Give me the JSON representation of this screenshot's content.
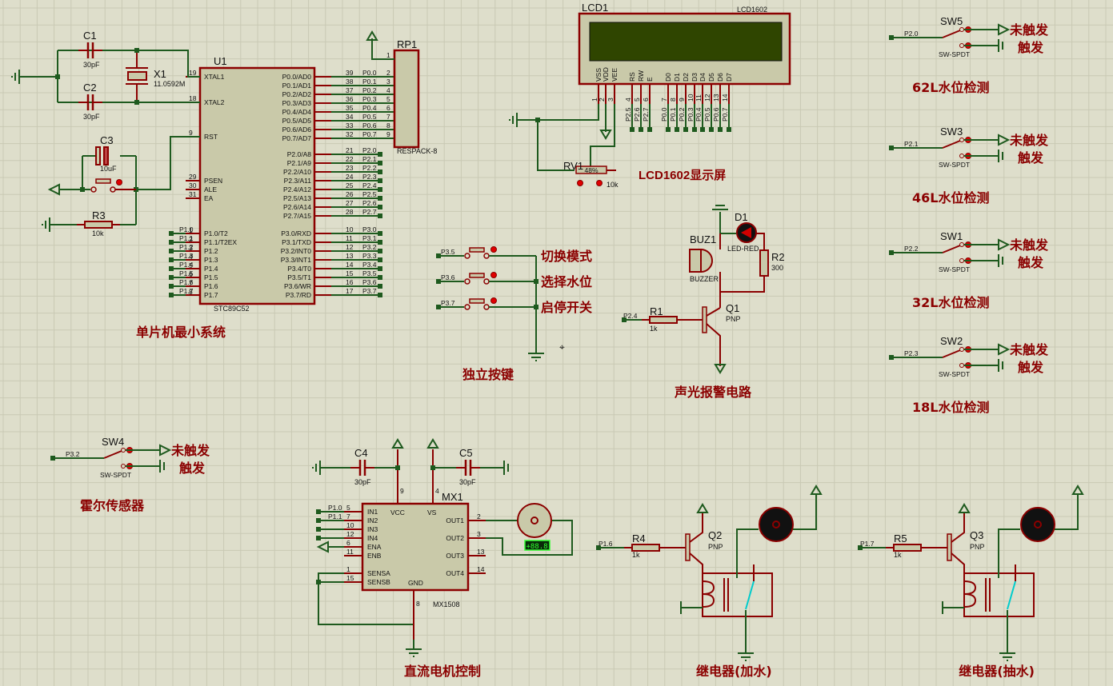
{
  "colors": {
    "background": "#dedecb",
    "grid": "#c9c9b4",
    "wire": "#1e5a1e",
    "component": "#8b0000",
    "body": "#c9c9a9",
    "lcd_screen": "#2f4500",
    "caption": "#8b0000"
  },
  "captions": {
    "mcu": "单片机最小系统",
    "lcd": "LCD1602显示屏",
    "keys": "独立按键",
    "alarm": "声光报警电路",
    "hall": "霍尔传感器",
    "motor": "直流电机控制",
    "relay_add": "继电器(加水)",
    "relay_pump": "继电器(抽水)"
  },
  "u1": {
    "ref": "U1",
    "part": "STC89C52",
    "left": [
      {
        "num": "19",
        "name": "XTAL1"
      },
      {
        "num": "18",
        "name": "XTAL2"
      },
      {
        "num": "9",
        "name": "RST"
      },
      {
        "num": "29",
        "name": "PSEN"
      },
      {
        "num": "30",
        "name": "ALE"
      },
      {
        "num": "31",
        "name": "EA"
      }
    ],
    "p1": [
      {
        "num": "1",
        "name": "P1.0/T2",
        "net": "P1.0"
      },
      {
        "num": "2",
        "name": "P1.1/T2EX",
        "net": "P1.1"
      },
      {
        "num": "3",
        "name": "P1.2",
        "net": "P1.2"
      },
      {
        "num": "4",
        "name": "P1.3",
        "net": "P1.3"
      },
      {
        "num": "5",
        "name": "P1.4",
        "net": "P1.4"
      },
      {
        "num": "6",
        "name": "P1.5",
        "net": "P1.5"
      },
      {
        "num": "7",
        "name": "P1.6",
        "net": "P1.6"
      },
      {
        "num": "8",
        "name": "P1.7",
        "net": "P1.7"
      }
    ],
    "p0": [
      {
        "num": "39",
        "name": "P0.0/AD0",
        "net": "P0.0",
        "rp": "2"
      },
      {
        "num": "38",
        "name": "P0.1/AD1",
        "net": "P0.1",
        "rp": "3"
      },
      {
        "num": "37",
        "name": "P0.2/AD2",
        "net": "P0.2",
        "rp": "4"
      },
      {
        "num": "36",
        "name": "P0.3/AD3",
        "net": "P0.3",
        "rp": "5"
      },
      {
        "num": "35",
        "name": "P0.4/AD4",
        "net": "P0.4",
        "rp": "6"
      },
      {
        "num": "34",
        "name": "P0.5/AD5",
        "net": "P0.5",
        "rp": "7"
      },
      {
        "num": "33",
        "name": "P0.6/AD6",
        "net": "P0.6",
        "rp": "8"
      },
      {
        "num": "32",
        "name": "P0.7/AD7",
        "net": "P0.7",
        "rp": "9"
      }
    ],
    "p2": [
      {
        "num": "21",
        "name": "P2.0/A8",
        "net": "P2.0"
      },
      {
        "num": "22",
        "name": "P2.1/A9",
        "net": "P2.1"
      },
      {
        "num": "23",
        "name": "P2.2/A10",
        "net": "P2.2"
      },
      {
        "num": "24",
        "name": "P2.3/A11",
        "net": "P2.3"
      },
      {
        "num": "25",
        "name": "P2.4/A12",
        "net": "P2.4"
      },
      {
        "num": "26",
        "name": "P2.5/A13",
        "net": "P2.5"
      },
      {
        "num": "27",
        "name": "P2.6/A14",
        "net": "P2.6"
      },
      {
        "num": "28",
        "name": "P2.7/A15",
        "net": "P2.7"
      }
    ],
    "p3": [
      {
        "num": "10",
        "name": "P3.0/RXD",
        "net": "P3.0"
      },
      {
        "num": "11",
        "name": "P3.1/TXD",
        "net": "P3.1"
      },
      {
        "num": "12",
        "name": "P3.2/INT0",
        "net": "P3.2"
      },
      {
        "num": "13",
        "name": "P3.3/INT1",
        "net": "P3.3"
      },
      {
        "num": "14",
        "name": "P3.4/T0",
        "net": "P3.4"
      },
      {
        "num": "15",
        "name": "P3.5/T1",
        "net": "P3.5"
      },
      {
        "num": "16",
        "name": "P3.6/WR",
        "net": "P3.6"
      },
      {
        "num": "17",
        "name": "P3.7/RD",
        "net": "P3.7"
      }
    ]
  },
  "rp1": {
    "ref": "RP1",
    "part": "RESPACK-8",
    "pin1": "1"
  },
  "x1": {
    "ref": "X1",
    "value": "11.0592M"
  },
  "c1": {
    "ref": "C1",
    "value": "30pF"
  },
  "c2": {
    "ref": "C2",
    "value": "30pF"
  },
  "c3": {
    "ref": "C3",
    "value": "10uF"
  },
  "c4": {
    "ref": "C4",
    "value": "30pF"
  },
  "c5": {
    "ref": "C5",
    "value": "30pF"
  },
  "r3": {
    "ref": "R3",
    "value": "10k"
  },
  "r1": {
    "ref": "R1",
    "value": "1k",
    "net": "P2.4"
  },
  "r2": {
    "ref": "R2",
    "value": "300"
  },
  "r4": {
    "ref": "R4",
    "value": "1k",
    "net": "P1.6"
  },
  "r5": {
    "ref": "R5",
    "value": "1k",
    "net": "P1.7"
  },
  "rv1": {
    "ref": "RV1",
    "value": "10k",
    "position": "48%"
  },
  "lcd1": {
    "ref": "LCD1",
    "part": "LCD1602",
    "pins": [
      {
        "name": "VSS",
        "num": "1",
        "net": ""
      },
      {
        "name": "VDD",
        "num": "2",
        "net": ""
      },
      {
        "name": "VEE",
        "num": "3",
        "net": ""
      },
      {
        "name": "RS",
        "num": "4",
        "net": "P2.5"
      },
      {
        "name": "RW",
        "num": "5",
        "net": "P2.6"
      },
      {
        "name": "E",
        "num": "6",
        "net": "P2.7"
      },
      {
        "name": "D0",
        "num": "7",
        "net": "P0.0"
      },
      {
        "name": "D1",
        "num": "8",
        "net": "P0.1"
      },
      {
        "name": "D2",
        "num": "9",
        "net": "P0.2"
      },
      {
        "name": "D3",
        "num": "10",
        "net": "P0.3"
      },
      {
        "name": "D4",
        "num": "11",
        "net": "P0.4"
      },
      {
        "name": "D5",
        "num": "12",
        "net": "P0.5"
      },
      {
        "name": "D6",
        "num": "13",
        "net": "P0.6"
      },
      {
        "name": "D7",
        "num": "14",
        "net": "P0.7"
      }
    ]
  },
  "keys": [
    {
      "net": "P3.5",
      "label": "切换模式"
    },
    {
      "net": "P3.6",
      "label": "选择水位"
    },
    {
      "net": "P3.7",
      "label": "启停开关"
    }
  ],
  "switches": [
    {
      "ref": "SW5",
      "part": "SW-SPDT",
      "net": "P2.0",
      "off": "未触发",
      "on": "触发",
      "caption": "62L水位检测"
    },
    {
      "ref": "SW3",
      "part": "SW-SPDT",
      "net": "P2.1",
      "off": "未触发",
      "on": "触发",
      "caption": "46L水位检测"
    },
    {
      "ref": "SW1",
      "part": "SW-SPDT",
      "net": "P2.2",
      "off": "未触发",
      "on": "触发",
      "caption": "32L水位检测"
    },
    {
      "ref": "SW2",
      "part": "SW-SPDT",
      "net": "P2.3",
      "off": "未触发",
      "on": "触发",
      "caption": "18L水位检测"
    },
    {
      "ref": "SW4",
      "part": "SW-SPDT",
      "net": "P3.2",
      "off": "未触发",
      "on": "触发",
      "caption": ""
    }
  ],
  "d1": {
    "ref": "D1",
    "part": "LED-RED"
  },
  "buz1": {
    "ref": "BUZ1",
    "part": "BUZZER"
  },
  "q1": {
    "ref": "Q1",
    "type": "PNP"
  },
  "q2": {
    "ref": "Q2",
    "type": "PNP"
  },
  "q3": {
    "ref": "Q3",
    "type": "PNP"
  },
  "mx1": {
    "ref": "MX1",
    "part": "MX1508",
    "vcc": "VCC",
    "vs": "VS",
    "gnd": "GND",
    "vcc_pin": "9",
    "vs_pin": "4",
    "gnd_pin": "8",
    "inputs": [
      {
        "num": "5",
        "name": "IN1",
        "net": "P1.0"
      },
      {
        "num": "7",
        "name": "IN2",
        "net": "P1.1"
      },
      {
        "num": "10",
        "name": "IN3",
        "net": ""
      },
      {
        "num": "12",
        "name": "IN4",
        "net": ""
      },
      {
        "num": "6",
        "name": "ENA",
        "net": ""
      },
      {
        "num": "11",
        "name": "ENB",
        "net": ""
      },
      {
        "num": "1",
        "name": "SENSA",
        "net": ""
      },
      {
        "num": "15",
        "name": "SENSB",
        "net": ""
      }
    ],
    "outputs": [
      {
        "num": "2",
        "name": "OUT1"
      },
      {
        "num": "3",
        "name": "OUT2"
      },
      {
        "num": "13",
        "name": "OUT3"
      },
      {
        "num": "14",
        "name": "OUT4"
      }
    ]
  },
  "motor_display": "+88.8"
}
